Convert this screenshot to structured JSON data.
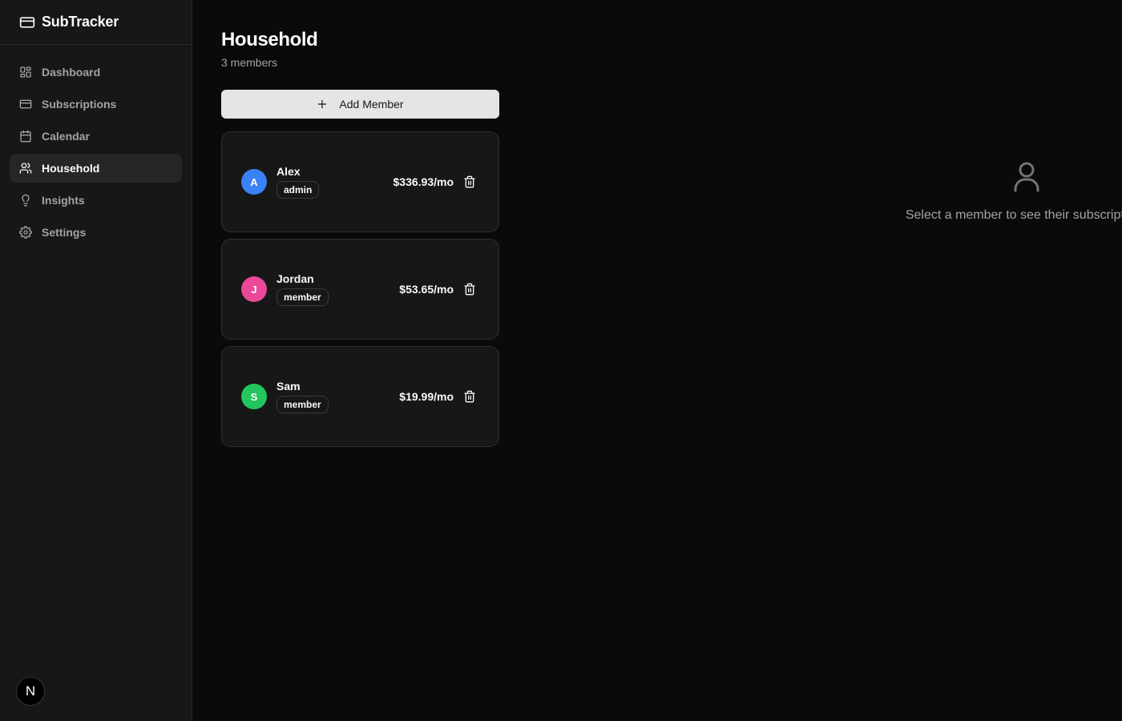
{
  "app": {
    "name": "SubTracker"
  },
  "sidebar": {
    "items": [
      {
        "label": "Dashboard",
        "icon": "layout-dashboard-icon",
        "active": false
      },
      {
        "label": "Subscriptions",
        "icon": "credit-card-icon",
        "active": false
      },
      {
        "label": "Calendar",
        "icon": "calendar-icon",
        "active": false
      },
      {
        "label": "Household",
        "icon": "users-icon",
        "active": true
      },
      {
        "label": "Insights",
        "icon": "lightbulb-icon",
        "active": false
      },
      {
        "label": "Settings",
        "icon": "settings-icon",
        "active": false
      }
    ],
    "user_initial": "N"
  },
  "page": {
    "title": "Household",
    "subtitle": "3 members"
  },
  "actions": {
    "add_member": "Add Member"
  },
  "members": [
    {
      "initial": "A",
      "name": "Alex",
      "role": "admin",
      "cost": "$336.93/mo",
      "color": "#3b82f6"
    },
    {
      "initial": "J",
      "name": "Jordan",
      "role": "member",
      "cost": "$53.65/mo",
      "color": "#ec4899"
    },
    {
      "initial": "S",
      "name": "Sam",
      "role": "member",
      "cost": "$19.99/mo",
      "color": "#22c55e"
    }
  ],
  "empty_state": {
    "text": "Select a member to see their subscriptions",
    "icon": "user-icon"
  },
  "colors": {
    "background": "#0a0a0a",
    "sidebar": "#171717",
    "card": "#171717",
    "accent": "#e5e5e5"
  }
}
